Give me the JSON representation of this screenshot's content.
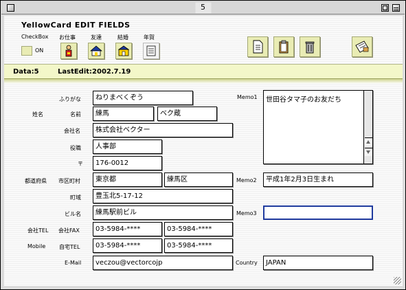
{
  "window": {
    "title": "5"
  },
  "header": {
    "app_title": "YellowCard EDIT FIELDS"
  },
  "toolbar": {
    "checkbox_label": "CheckBox",
    "checkbox_state": "ON",
    "category_labels": [
      "お仕事",
      "友達",
      "結婚",
      "年賀"
    ],
    "icon_names": [
      "person-icon",
      "house-icon",
      "church-icon",
      "card-icon",
      "document-icon",
      "clipboard-icon",
      "trash-icon",
      "letter-icon"
    ]
  },
  "status": {
    "data": "Data:5",
    "last_edit": "LastEdit:2002.7.19"
  },
  "labels": {
    "furigana": "ふりがな",
    "shimei": "姓名",
    "namae": "名前",
    "kaisha": "会社名",
    "yakushoku": "役職",
    "yubin": "〒",
    "todofuken": "都道府県",
    "shikuchoson": "市区町村",
    "choban": "町域",
    "biru": "ビル名",
    "kaisha_tel": "会社TEL",
    "kaisha_fax": "会社FAX",
    "mobile": "Mobile",
    "jitaku_tel": "自宅TEL",
    "email": "E-Mail",
    "memo1": "Memo1",
    "memo2": "Memo2",
    "memo3": "Memo3",
    "country": "Country"
  },
  "fields": {
    "furigana": "ねりまべくぞう",
    "sei": "練馬",
    "mei": "ベク蔵",
    "kaisha": "株式会社ベクター",
    "yakushoku": "人事部",
    "yubin": "176-0012",
    "todofuken": "東京都",
    "shikuchoson": "練馬区",
    "choban": "豊玉北5-17-12",
    "biru": "練馬駅前ビル",
    "kaisha_tel": "03-5984-****",
    "kaisha_fax": "03-5984-****",
    "mobile": "03-5984-****",
    "jitaku_tel": "03-5984-****",
    "email": "veczou@vectorcojp",
    "memo1": "世田谷タマ子のお友だち",
    "memo2": "平成1年2月3日生まれ",
    "memo3": "",
    "country": "JAPAN"
  },
  "colors": {
    "accent_band": "#f3f7c9",
    "active_border": "#1f3a9e",
    "icon_bg": "#e9ecb4"
  }
}
